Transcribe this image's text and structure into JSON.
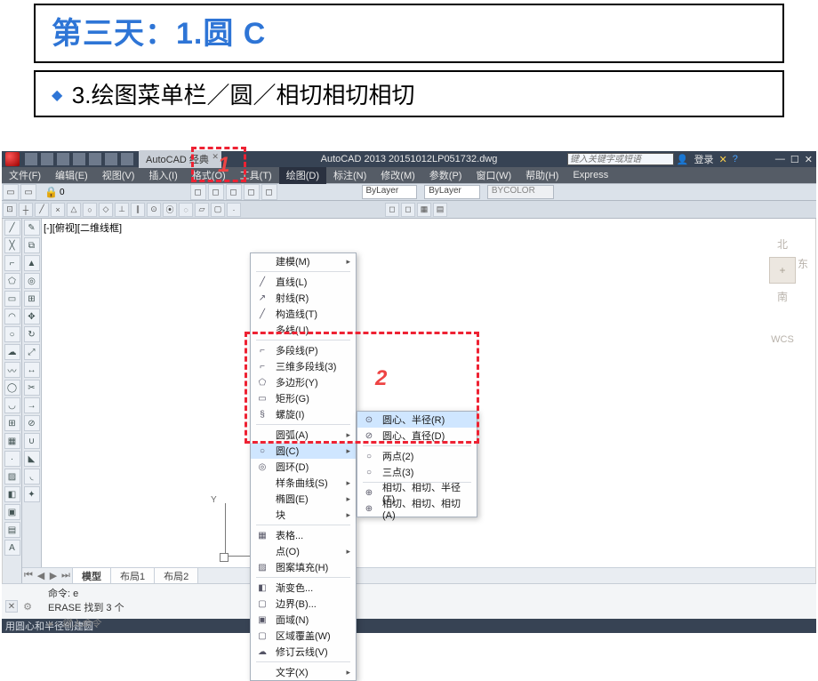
{
  "slide": {
    "title": "第三天：1.圆  C",
    "subtitle": "3.绘图菜单栏／圆／相切相切相切"
  },
  "annotations": {
    "num1": "1",
    "num2": "2"
  },
  "qat": {
    "classic_tab": "AutoCAD 经典",
    "center": "AutoCAD 2013   20151012LP051732.dwg",
    "search_placeholder": "键入关键字或短语",
    "login": "登录"
  },
  "menubar": {
    "items": [
      "文件(F)",
      "编辑(E)",
      "视图(V)",
      "插入(I)",
      "格式(O)",
      "工具(T)",
      "绘图(D)",
      "标注(N)",
      "修改(M)",
      "参数(P)",
      "窗口(W)",
      "帮助(H)",
      "Express"
    ]
  },
  "layerbar": {
    "bylayer1": "ByLayer",
    "bylayer2": "ByLayer",
    "bycolor": "BYCOLOR"
  },
  "filetab": "[-][俯视][二维线框]",
  "compass": {
    "north": "北",
    "east": "东",
    "south": "南",
    "wcs": "WCS"
  },
  "draw_menu": {
    "items": [
      {
        "label": "建模(M)",
        "arrow": true,
        "sepAfter": true
      },
      {
        "label": "直线(L)"
      },
      {
        "label": "射线(R)"
      },
      {
        "label": "构造线(T)"
      },
      {
        "label": "多线(U)",
        "sepAfter": true
      },
      {
        "label": "多段线(P)"
      },
      {
        "label": "三维多段线(3)"
      },
      {
        "label": "多边形(Y)"
      },
      {
        "label": "矩形(G)"
      },
      {
        "label": "螺旋(I)",
        "sepAfter": true
      },
      {
        "label": "圆弧(A)",
        "arrow": true
      },
      {
        "label": "圆(C)",
        "arrow": true,
        "hl": true
      },
      {
        "label": "圆环(D)"
      },
      {
        "label": "样条曲线(S)",
        "arrow": true
      },
      {
        "label": "椭圆(E)",
        "arrow": true
      },
      {
        "label": "块",
        "arrow": true,
        "sepAfter": true
      },
      {
        "label": "表格..."
      },
      {
        "label": "点(O)",
        "arrow": true
      },
      {
        "label": "图案填充(H)",
        "cut": true,
        "sepAfter": true
      },
      {
        "label": "渐变色..."
      },
      {
        "label": "边界(B)..."
      },
      {
        "label": "面域(N)"
      },
      {
        "label": "区域覆盖(W)"
      },
      {
        "label": "修订云线(V)",
        "sepAfter": true
      },
      {
        "label": "文字(X)",
        "arrow": true
      }
    ]
  },
  "circle_submenu": {
    "items": [
      {
        "label": "圆心、半径(R)",
        "hl": true
      },
      {
        "label": "圆心、直径(D)",
        "sepAfter": true
      },
      {
        "label": "两点(2)"
      },
      {
        "label": "三点(3)",
        "sepAfter": true
      },
      {
        "label": "相切、相切、半径(T)"
      },
      {
        "label": "相切、相切、相切(A)"
      }
    ]
  },
  "sheets": {
    "t1": "模型",
    "t2": "布局1",
    "t3": "布局2"
  },
  "cmd": {
    "l1": "命令: e",
    "l2": "ERASE 找到 3 个",
    "hint": "▸ - 键入命令"
  },
  "status": "用圆心和半径创建圆"
}
